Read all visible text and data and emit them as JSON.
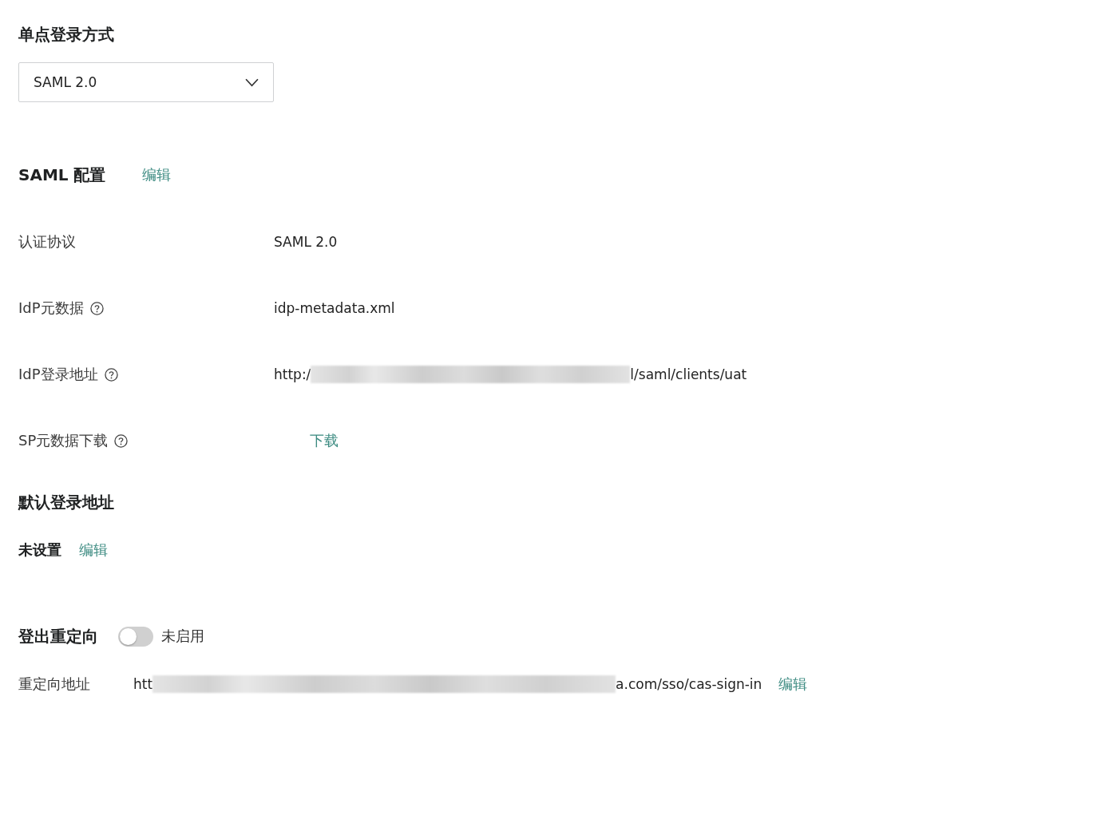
{
  "sso_method": {
    "title": "单点登录方式",
    "dropdown": {
      "value": "SAML 2.0"
    }
  },
  "saml_config": {
    "title": "SAML 配置",
    "edit_link": "编辑",
    "fields": [
      {
        "kind": "text",
        "label": "认证协议",
        "help": false,
        "value": "SAML 2.0"
      },
      {
        "kind": "text",
        "label": "IdP元数据",
        "help": true,
        "value": "idp-metadata.xml"
      },
      {
        "kind": "redacted",
        "label": "IdP登录地址",
        "help": true,
        "value_start": "http:/",
        "value_end": "l/saml/clients/uat"
      },
      {
        "kind": "link",
        "label": "SP元数据下载",
        "help": true,
        "value": "下载"
      }
    ]
  },
  "default_login_url": {
    "title": "默认登录地址",
    "value": "未设置",
    "edit_link": "编辑"
  },
  "logout_redirect": {
    "title": "登出重定向",
    "toggle": {
      "on": false,
      "label": "未启用"
    },
    "url": {
      "label": "重定向地址",
      "value_start": "htt",
      "value_end": "a.com/sso/cas-sign-in",
      "edit_link": "编辑"
    }
  }
}
